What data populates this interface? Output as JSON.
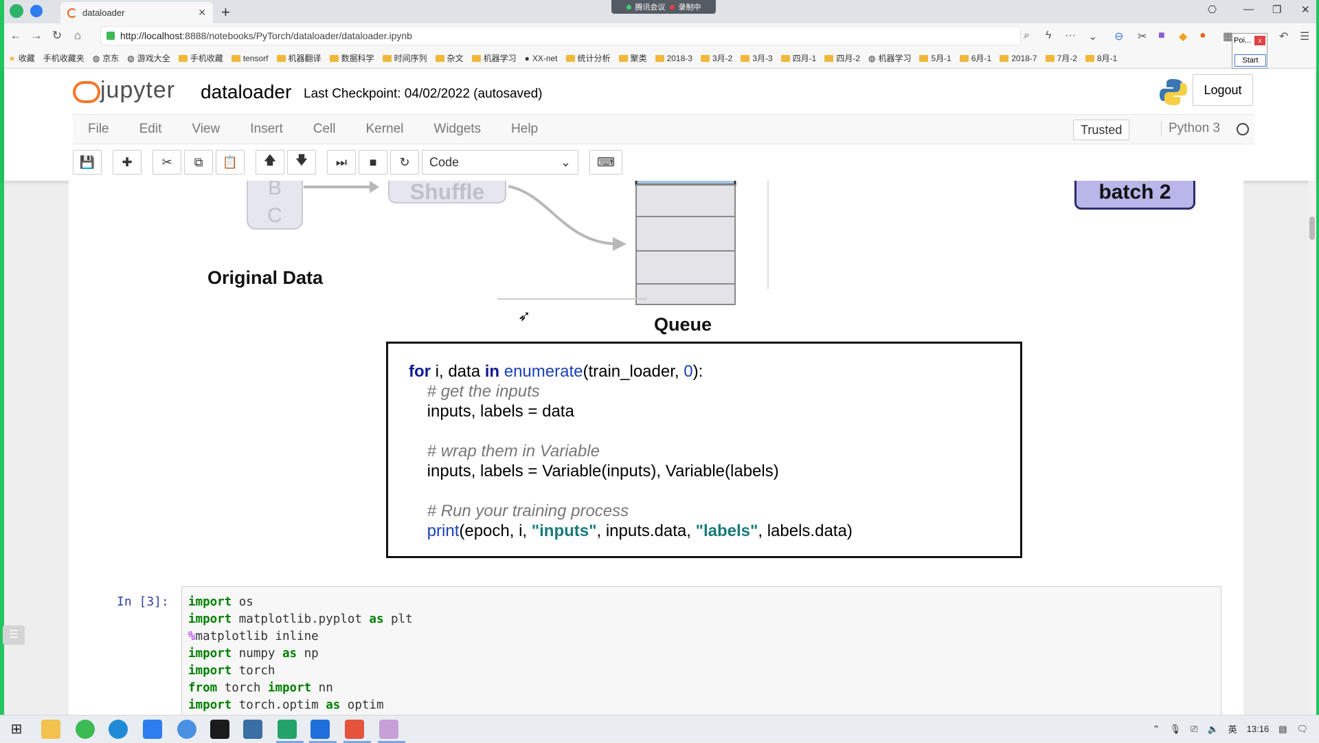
{
  "browser": {
    "tab_title": "dataloader",
    "url_host": "http://localhost",
    "url_rest": ":8888/notebooks/PyTorch/dataloader/dataloader.ipynb",
    "meeting_label": "腾讯会议",
    "recording_label": "录制中",
    "bookmarks": [
      "收藏",
      "手机收藏夹",
      "京东",
      "游戏大全",
      "手机收藏",
      "tensorf",
      "机器翻译",
      "数据科学",
      "时间序列",
      "杂文",
      "机器学习",
      "XX-net",
      "统计分析",
      "聚类",
      "2018-3",
      "3月-2",
      "3月-3",
      "四月-1",
      "四月-2",
      "机器学习",
      "5月-1",
      "6月-1",
      "2018-7",
      "7月-2",
      "8月-1"
    ],
    "popup_title": "Poi...",
    "popup_start": "Start"
  },
  "jupyter": {
    "logo_text": "jupyter",
    "notebook_name": "dataloader",
    "checkpoint": "Last Checkpoint: 04/02/2022 (autosaved)",
    "logout": "Logout",
    "menu": [
      "File",
      "Edit",
      "View",
      "Insert",
      "Cell",
      "Kernel",
      "Widgets",
      "Help"
    ],
    "trusted": "Trusted",
    "kernel": "Python 3",
    "cell_type": "Code"
  },
  "diagram": {
    "letters": [
      "B",
      "C"
    ],
    "shuffle": "Shuffle",
    "original_data": "Original Data",
    "queue": "Queue",
    "batch2": "batch 2",
    "code_lines": {
      "l1_for": "for",
      "l1_a": " i, data ",
      "l1_in": "in",
      "l1_fn": " enumerate",
      "l1_b": "(train_loader, ",
      "l1_num": "0",
      "l1_c": "):",
      "l2": "    # get the inputs",
      "l3": "    inputs, labels = data",
      "l5": "    # wrap them in Variable",
      "l6": "    inputs, labels = Variable(inputs), Variable(labels)",
      "l8": "    # Run your training process",
      "l9_print": "    print",
      "l9_a": "(epoch, i, ",
      "l9_s1": "\"inputs\"",
      "l9_b": ", inputs.data, ",
      "l9_s2": "\"labels\"",
      "l9_c": ", labels.data)"
    }
  },
  "cell": {
    "prompt": "In  [3]:",
    "lines": [
      {
        "kw": "import",
        "rest": " os"
      },
      {
        "kw": "import",
        "rest": " matplotlib.pyplot ",
        "kw2": "as",
        "rest2": " plt"
      },
      {
        "magic": "%",
        "rest": "matplotlib inline"
      },
      {
        "kw": "import",
        "rest": " numpy ",
        "kw2": "as",
        "rest2": " np"
      },
      {
        "kw": "import",
        "rest": " torch"
      },
      {
        "kw": "from",
        "rest": " torch ",
        "kw2": "import",
        "rest2": " nn"
      },
      {
        "kw": "import",
        "rest": " torch.optim ",
        "kw2": "as",
        "rest2": " optim"
      }
    ]
  },
  "taskbar": {
    "time": "13:16",
    "ime": "英"
  }
}
